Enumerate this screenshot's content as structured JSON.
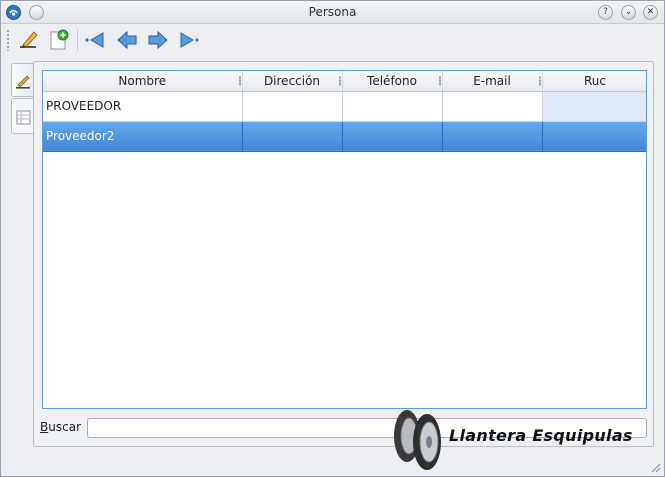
{
  "window": {
    "title": "Persona",
    "controls": [
      "help-icon",
      "minimize-icon",
      "close-icon"
    ],
    "control_glyphs": {
      "help": "?",
      "minimize": "⌄",
      "close": "✕"
    }
  },
  "toolbar": {
    "tools": [
      {
        "name": "edit-icon"
      },
      {
        "name": "new-document-icon"
      },
      {
        "name": "first-record-icon"
      },
      {
        "name": "previous-record-icon"
      },
      {
        "name": "next-record-icon"
      },
      {
        "name": "last-record-icon"
      }
    ]
  },
  "tabs": [
    {
      "name": "edit-tab-icon",
      "active": false
    },
    {
      "name": "table-tab-icon",
      "active": true
    }
  ],
  "table": {
    "columns": [
      "Nombre",
      "Dirección",
      "Teléfono",
      "E-mail",
      "Ruc"
    ],
    "rows": [
      {
        "cells": [
          "PROVEEDOR",
          "",
          "",
          "",
          ""
        ],
        "selected": false
      },
      {
        "cells": [
          "Proveedor2",
          "",
          "",
          "",
          ""
        ],
        "selected": true
      }
    ]
  },
  "search": {
    "label_mnemonic": "B",
    "label_rest": "uscar",
    "value": ""
  },
  "logo": {
    "text": "Llantera Esquipulas"
  },
  "colors": {
    "selection": "#4a90dc",
    "table_border": "#5f9cd9",
    "window_bg": "#eceef1"
  }
}
